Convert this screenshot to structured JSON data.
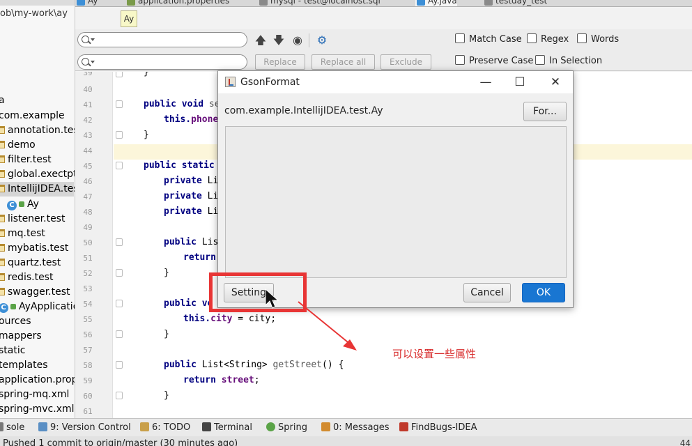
{
  "tabs": [
    {
      "label": "Ay"
    },
    {
      "label": "application.properties"
    },
    {
      "label": "mysql - test@localhost.sql"
    },
    {
      "label": "Ay.java"
    },
    {
      "label": "testday_test"
    }
  ],
  "tree": {
    "path": "ob\\my-work\\ay",
    "items": [
      {
        "label": "a",
        "kind": "text"
      },
      {
        "label": "com.example",
        "kind": "text"
      },
      {
        "label": "annotation.test",
        "kind": "folder"
      },
      {
        "label": "demo",
        "kind": "folder"
      },
      {
        "label": "filter.test",
        "kind": "folder"
      },
      {
        "label": "global.exectpt",
        "kind": "folder"
      },
      {
        "label": "IntellijIDEA.test",
        "kind": "folder"
      },
      {
        "label": "Ay",
        "kind": "class"
      },
      {
        "label": "listener.test",
        "kind": "folder"
      },
      {
        "label": "mq.test",
        "kind": "folder"
      },
      {
        "label": "mybatis.test",
        "kind": "folder"
      },
      {
        "label": "quartz.test",
        "kind": "folder"
      },
      {
        "label": "redis.test",
        "kind": "folder"
      },
      {
        "label": "swagger.test",
        "kind": "folder"
      },
      {
        "label": "AyApplication",
        "kind": "class"
      },
      {
        "label": "ources",
        "kind": "text"
      },
      {
        "label": "mappers",
        "kind": "text"
      },
      {
        "label": "static",
        "kind": "text"
      },
      {
        "label": "templates",
        "kind": "text"
      },
      {
        "label": "application.prope",
        "kind": "text"
      },
      {
        "label": "spring-mq.xml",
        "kind": "text"
      },
      {
        "label": "spring-mvc.xml",
        "kind": "text"
      }
    ]
  },
  "tooltip": "Ay",
  "find": {
    "search_value": "",
    "replace_value": "",
    "replace_label": "Replace",
    "replace_all_label": "Replace all",
    "exclude_label": "Exclude",
    "match_case": "Match Case",
    "regex": "Regex",
    "words": "Words",
    "preserve_case": "Preserve Case",
    "in_selection": "In Selection"
  },
  "editor": {
    "line_numbers": [
      "39",
      "40",
      "41",
      "42",
      "43",
      "44",
      "45",
      "46",
      "47",
      "48",
      "49",
      "50",
      "51",
      "52",
      "53",
      "54",
      "55",
      "56",
      "57",
      "58",
      "59",
      "60",
      "61"
    ],
    "l39": "}",
    "l41_kw": "public void ",
    "l41_rest": "se",
    "l42_kw": "this.",
    "l42_fld": "phone",
    "l43": "}",
    "l45_kw": "public static",
    "l46_kw": "private ",
    "l46_rest": "Li",
    "l47_kw": "private ",
    "l47_rest": "Li",
    "l48_kw": "private ",
    "l48_rest": "Li",
    "l50_kw": "public ",
    "l50_rest": "List",
    "l51_kw": "return",
    "l52": "}",
    "l54_kw": "public ",
    "l54_rest": "vo",
    "l55_kw": "this.",
    "l55_fld": "city",
    "l55_rest": " = city;",
    "l56": "}",
    "l58_kw": "public ",
    "l58_rest": "List<String> ",
    "l58_mth": "getStreet",
    "l58_end": "() {",
    "l59_kw": "return ",
    "l59_fld": "street",
    "l59_end": ";",
    "l60": "}"
  },
  "dialog": {
    "title": "GsonFormat",
    "class_name": "com.example.IntellijIDEA.test.Ay",
    "format_label": "For...",
    "json_value": "",
    "setting_label": "Setting",
    "cancel_label": "Cancel",
    "ok_label": "OK",
    "accent": "#1976d2"
  },
  "annotation": {
    "note": "可以设置一些属性",
    "color": "#e83535"
  },
  "toolwindows": [
    {
      "label": "sole",
      "icon": "console-icon"
    },
    {
      "label": "9: Version Control",
      "icon": "vcs-icon"
    },
    {
      "label": "6: TODO",
      "icon": "todo-icon"
    },
    {
      "label": "Terminal",
      "icon": "terminal-icon"
    },
    {
      "label": "Spring",
      "icon": "spring-icon"
    },
    {
      "label": "0: Messages",
      "icon": "messages-icon"
    },
    {
      "label": "FindBugs-IDEA",
      "icon": "findbugs-icon"
    }
  ],
  "status": {
    "message": "Pushed 1 commit to origin/master (30 minutes ago)",
    "right": "44"
  }
}
